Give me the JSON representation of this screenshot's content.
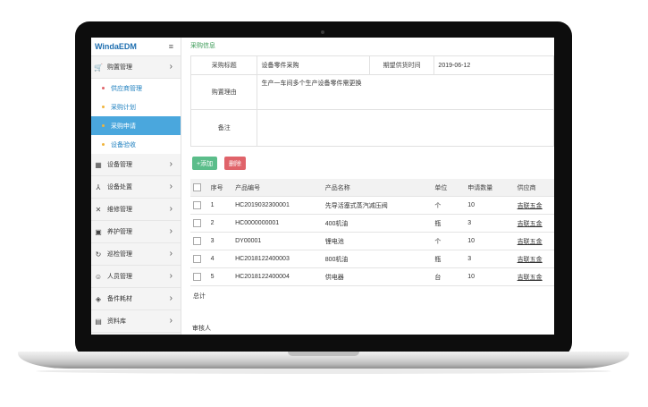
{
  "app": {
    "brand": "WindaEDM",
    "menu_icon": "hamburger-icon"
  },
  "sidebar": {
    "items": [
      {
        "label": "购置管理",
        "icon": "cart-icon"
      },
      {
        "label": "设备管理",
        "icon": "grid-icon"
      },
      {
        "label": "设备处置",
        "icon": "share-icon"
      },
      {
        "label": "维修管理",
        "icon": "wrench-icon"
      },
      {
        "label": "养护管理",
        "icon": "image-icon"
      },
      {
        "label": "巡检管理",
        "icon": "refresh-icon"
      },
      {
        "label": "人员管理",
        "icon": "users-icon"
      },
      {
        "label": "备件耗材",
        "icon": "box-icon"
      },
      {
        "label": "资料库",
        "icon": "book-icon"
      }
    ],
    "sub_items": [
      {
        "label": "供应商管理",
        "dot": "#e0636a",
        "active": false
      },
      {
        "label": "采购计划",
        "dot": "#f0b43c",
        "active": false
      },
      {
        "label": "采购申请",
        "dot": "#f0b43c",
        "active": true
      },
      {
        "label": "设备验收",
        "dot": "#f0b43c",
        "active": false
      }
    ]
  },
  "form": {
    "section_title": "采购信息",
    "title_label": "采购标题",
    "title_value": "设备零件采购",
    "date_label": "期望供货时间",
    "date_value": "2019-06-12",
    "reason_label": "购置理由",
    "reason_value": "生产一车间多个生产设备零件需更换",
    "note_label": "备注",
    "note_value": ""
  },
  "toolbar": {
    "add_label": "+添加",
    "delete_label": "删除"
  },
  "table": {
    "headers": [
      "序号",
      "产品编号",
      "产品名称",
      "单位",
      "申请数量",
      "供应商"
    ],
    "rows": [
      {
        "no": "1",
        "code": "HC2019032300001",
        "name": "先导活塞式蒸汽减压阀",
        "unit": "个",
        "qty": "10",
        "supplier": "吉联五金"
      },
      {
        "no": "2",
        "code": "HC0000000001",
        "name": "400机油",
        "unit": "瓶",
        "qty": "3",
        "supplier": "吉联五金"
      },
      {
        "no": "3",
        "code": "DY00001",
        "name": "锂电池",
        "unit": "个",
        "qty": "10",
        "supplier": "吉联五金"
      },
      {
        "no": "4",
        "code": "HC2018122400003",
        "name": "800机油",
        "unit": "瓶",
        "qty": "3",
        "supplier": "吉联五金"
      },
      {
        "no": "5",
        "code": "HC2018122400004",
        "name": "供电器",
        "unit": "台",
        "qty": "10",
        "supplier": "吉联五金"
      }
    ],
    "total_label": "总计"
  },
  "review": {
    "label": "审核人"
  },
  "colors": {
    "brand": "#1f6fb0",
    "active_nav": "#4aa7dd",
    "add": "#5bbd8a",
    "delete": "#e0636a",
    "section": "#3a9a55"
  }
}
